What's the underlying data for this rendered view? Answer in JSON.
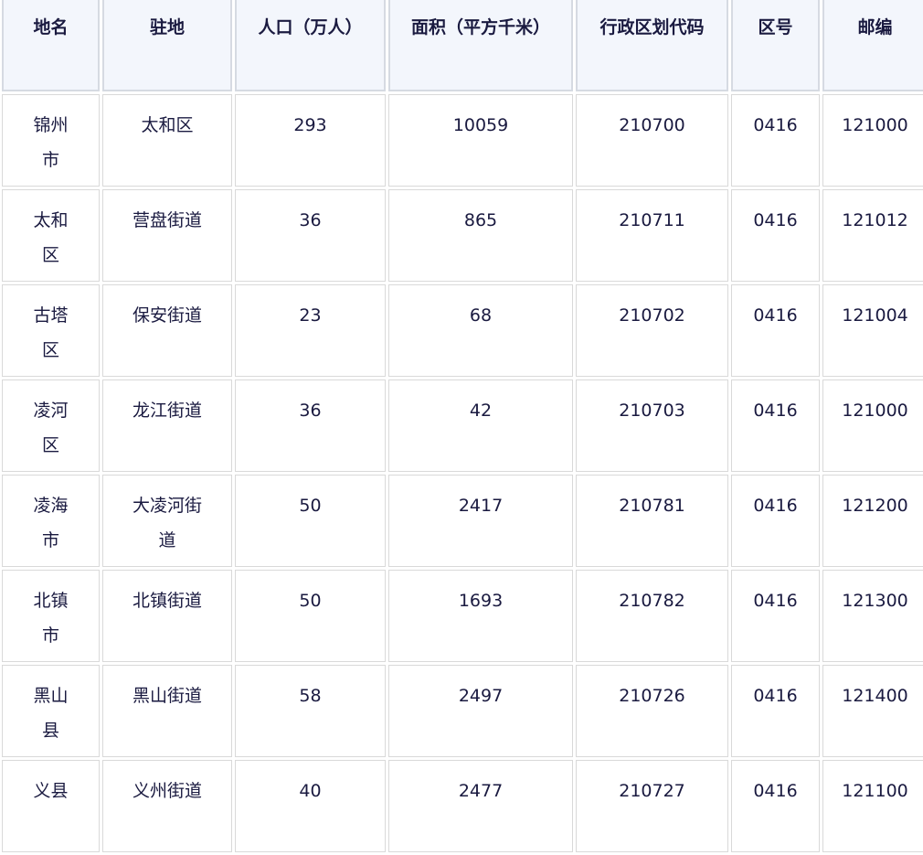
{
  "table": {
    "headers": [
      "地名",
      "驻地",
      "人口（万人）",
      "面积（平方千米）",
      "行政区划代码",
      "区号",
      "邮编"
    ],
    "rows": [
      [
        "锦州市",
        "太和区",
        "293",
        "10059",
        "210700",
        "0416",
        "121000"
      ],
      [
        "太和区",
        "营盘街道",
        "36",
        "865",
        "210711",
        "0416",
        "121012"
      ],
      [
        "古塔区",
        "保安街道",
        "23",
        "68",
        "210702",
        "0416",
        "121004"
      ],
      [
        "凌河区",
        "龙江街道",
        "36",
        "42",
        "210703",
        "0416",
        "121000"
      ],
      [
        "凌海市",
        "大凌河街道",
        "50",
        "2417",
        "210781",
        "0416",
        "121200"
      ],
      [
        "北镇市",
        "北镇街道",
        "50",
        "1693",
        "210782",
        "0416",
        "121300"
      ],
      [
        "黑山县",
        "黑山街道",
        "58",
        "2497",
        "210726",
        "0416",
        "121400"
      ],
      [
        "义县",
        "义州街道",
        "40",
        "2477",
        "210727",
        "0416",
        "121100"
      ]
    ]
  }
}
